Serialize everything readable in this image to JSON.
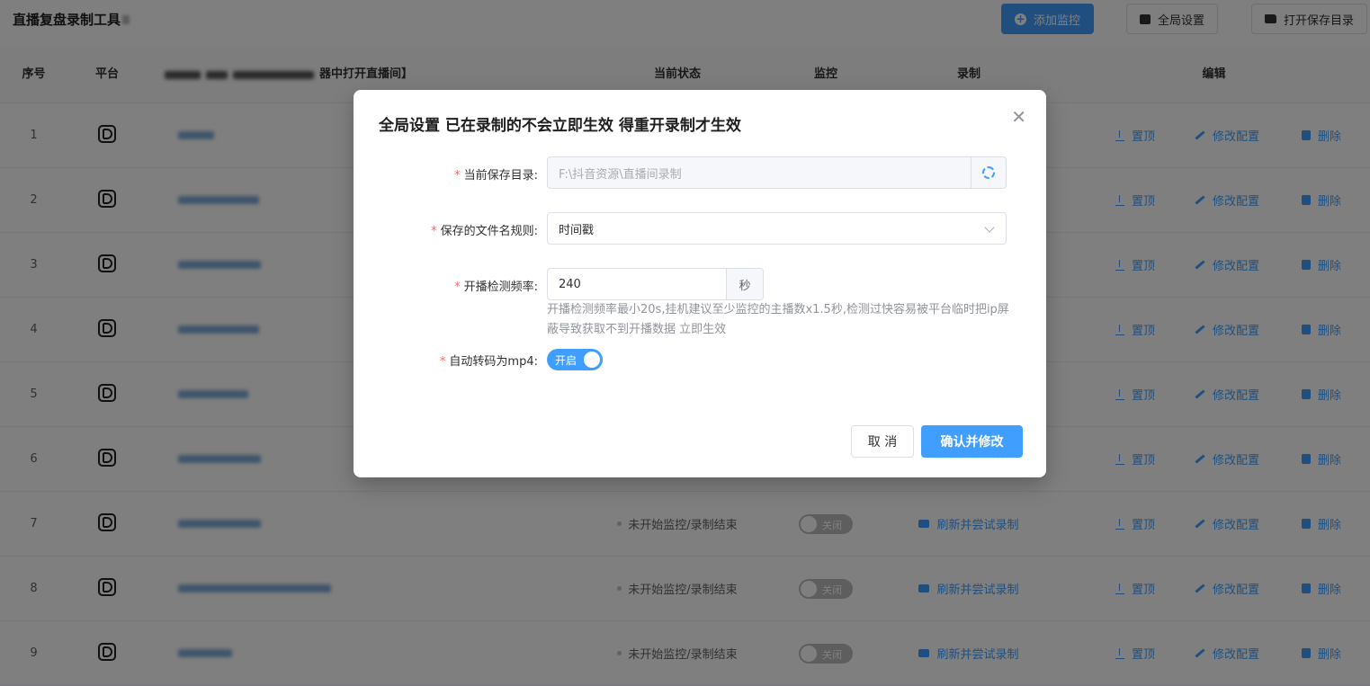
{
  "app": {
    "title": "直播复盘录制工具"
  },
  "toolbar": {
    "add_monitor": "添加监控",
    "global_settings": "全局设置",
    "open_save_dir": "打开保存目录"
  },
  "table": {
    "headers": {
      "index": "序号",
      "platform": "平台",
      "name_suffix": "器中打开直播间】",
      "status": "当前状态",
      "monitor": "监控",
      "record": "录制",
      "edit": "编辑"
    },
    "rows": [
      {
        "index": "1"
      },
      {
        "index": "2"
      },
      {
        "index": "3"
      },
      {
        "index": "4"
      },
      {
        "index": "5"
      },
      {
        "index": "6"
      },
      {
        "index": "7",
        "status": "未开始监控/录制结束",
        "monitor_switch": "关闭",
        "record_action": "刷新并尝试录制"
      },
      {
        "index": "8",
        "status": "未开始监控/录制结束",
        "monitor_switch": "关闭",
        "record_action": "刷新并尝试录制"
      },
      {
        "index": "9",
        "status": "未开始监控/录制结束",
        "monitor_switch": "关闭",
        "record_action": "刷新并尝试录制"
      }
    ],
    "row_actions": {
      "pin": "置顶",
      "edit_config": "修改配置",
      "delete": "删除"
    }
  },
  "dialog": {
    "title": "全局设置 已在录制的不会立即生效 得重开录制才生效",
    "fields": {
      "save_dir": {
        "label": "当前保存目录:",
        "placeholder": "F:\\抖音资源\\直播间录制"
      },
      "filename_rule": {
        "label": "保存的文件名规则:",
        "value": "时间戳"
      },
      "check_freq": {
        "label": "开播检测频率:",
        "value": "240",
        "unit": "秒",
        "hint": "开播检测频率最小20s,挂机建议至少监控的主播数x1.5秒,检测过快容易被平台临时把ip屏蔽导致获取不到开播数据 立即生效"
      },
      "auto_mp4": {
        "label": "自动转码为mp4:",
        "switch_label": "开启"
      }
    },
    "cancel": "取 消",
    "confirm": "确认并修改"
  },
  "colors": {
    "accent": "#409eff",
    "required": "#f56c6c",
    "overlay": "rgba(0,0,0,0.5)"
  },
  "icons": {
    "add": "plus-circle-icon",
    "settings": "sliders-icon",
    "folder": "folder-icon",
    "platform": "douyin-d-icon",
    "record": "video-camera-icon",
    "pin": "upload-icon",
    "edit": "pencil-icon",
    "delete": "trash-icon",
    "gear": "gear-icon",
    "close": "close-icon"
  }
}
